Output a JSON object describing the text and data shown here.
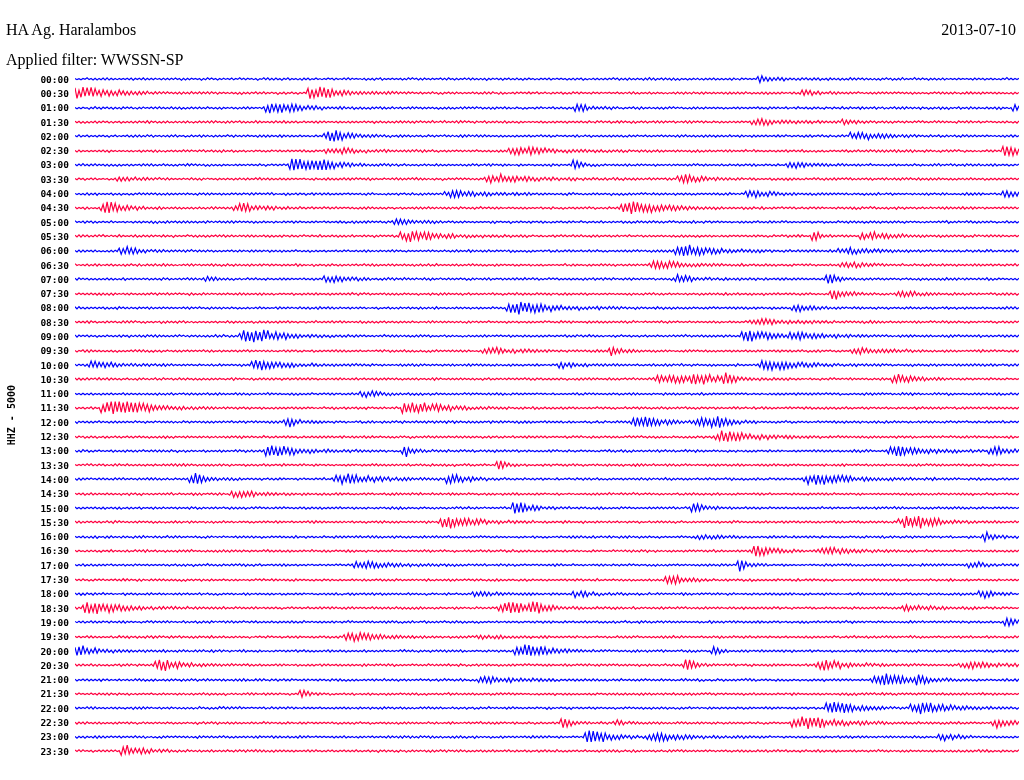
{
  "header": {
    "station": "HA Ag. Haralambos",
    "date": "2013-07-10",
    "filter": "Applied filter: WWSSN-SP"
  },
  "axis_label": "HHZ - 5000",
  "rows": [
    {
      "time": "00:00",
      "color": "#0000ff"
    },
    {
      "time": "00:30",
      "color": "#ff0040"
    },
    {
      "time": "01:00",
      "color": "#0000ff"
    },
    {
      "time": "01:30",
      "color": "#ff0040"
    },
    {
      "time": "02:00",
      "color": "#0000ff"
    },
    {
      "time": "02:30",
      "color": "#ff0040"
    },
    {
      "time": "03:00",
      "color": "#0000ff"
    },
    {
      "time": "03:30",
      "color": "#ff0040"
    },
    {
      "time": "04:00",
      "color": "#0000ff"
    },
    {
      "time": "04:30",
      "color": "#ff0040"
    },
    {
      "time": "05:00",
      "color": "#0000ff"
    },
    {
      "time": "05:30",
      "color": "#ff0040"
    },
    {
      "time": "06:00",
      "color": "#0000ff"
    },
    {
      "time": "06:30",
      "color": "#ff0040"
    },
    {
      "time": "07:00",
      "color": "#0000ff"
    },
    {
      "time": "07:30",
      "color": "#ff0040"
    },
    {
      "time": "08:00",
      "color": "#0000ff"
    },
    {
      "time": "08:30",
      "color": "#ff0040"
    },
    {
      "time": "09:00",
      "color": "#0000ff"
    },
    {
      "time": "09:30",
      "color": "#ff0040"
    },
    {
      "time": "10:00",
      "color": "#0000ff"
    },
    {
      "time": "10:30",
      "color": "#ff0040"
    },
    {
      "time": "11:00",
      "color": "#0000ff"
    },
    {
      "time": "11:30",
      "color": "#ff0040"
    },
    {
      "time": "12:00",
      "color": "#0000ff"
    },
    {
      "time": "12:30",
      "color": "#ff0040"
    },
    {
      "time": "13:00",
      "color": "#0000ff"
    },
    {
      "time": "13:30",
      "color": "#ff0040"
    },
    {
      "time": "14:00",
      "color": "#0000ff"
    },
    {
      "time": "14:30",
      "color": "#ff0040"
    },
    {
      "time": "15:00",
      "color": "#0000ff"
    },
    {
      "time": "15:30",
      "color": "#ff0040"
    },
    {
      "time": "16:00",
      "color": "#0000ff"
    },
    {
      "time": "16:30",
      "color": "#ff0040"
    },
    {
      "time": "17:00",
      "color": "#0000ff"
    },
    {
      "time": "17:30",
      "color": "#ff0040"
    },
    {
      "time": "18:00",
      "color": "#0000ff"
    },
    {
      "time": "18:30",
      "color": "#ff0040"
    },
    {
      "time": "19:00",
      "color": "#0000ff"
    },
    {
      "time": "19:30",
      "color": "#ff0040"
    },
    {
      "time": "20:00",
      "color": "#0000ff"
    },
    {
      "time": "20:30",
      "color": "#ff0040"
    },
    {
      "time": "21:00",
      "color": "#0000ff"
    },
    {
      "time": "21:30",
      "color": "#ff0040"
    },
    {
      "time": "22:00",
      "color": "#0000ff"
    },
    {
      "time": "22:30",
      "color": "#ff0040"
    },
    {
      "time": "23:00",
      "color": "#0000ff"
    },
    {
      "time": "23:30",
      "color": "#ff0040"
    }
  ]
}
